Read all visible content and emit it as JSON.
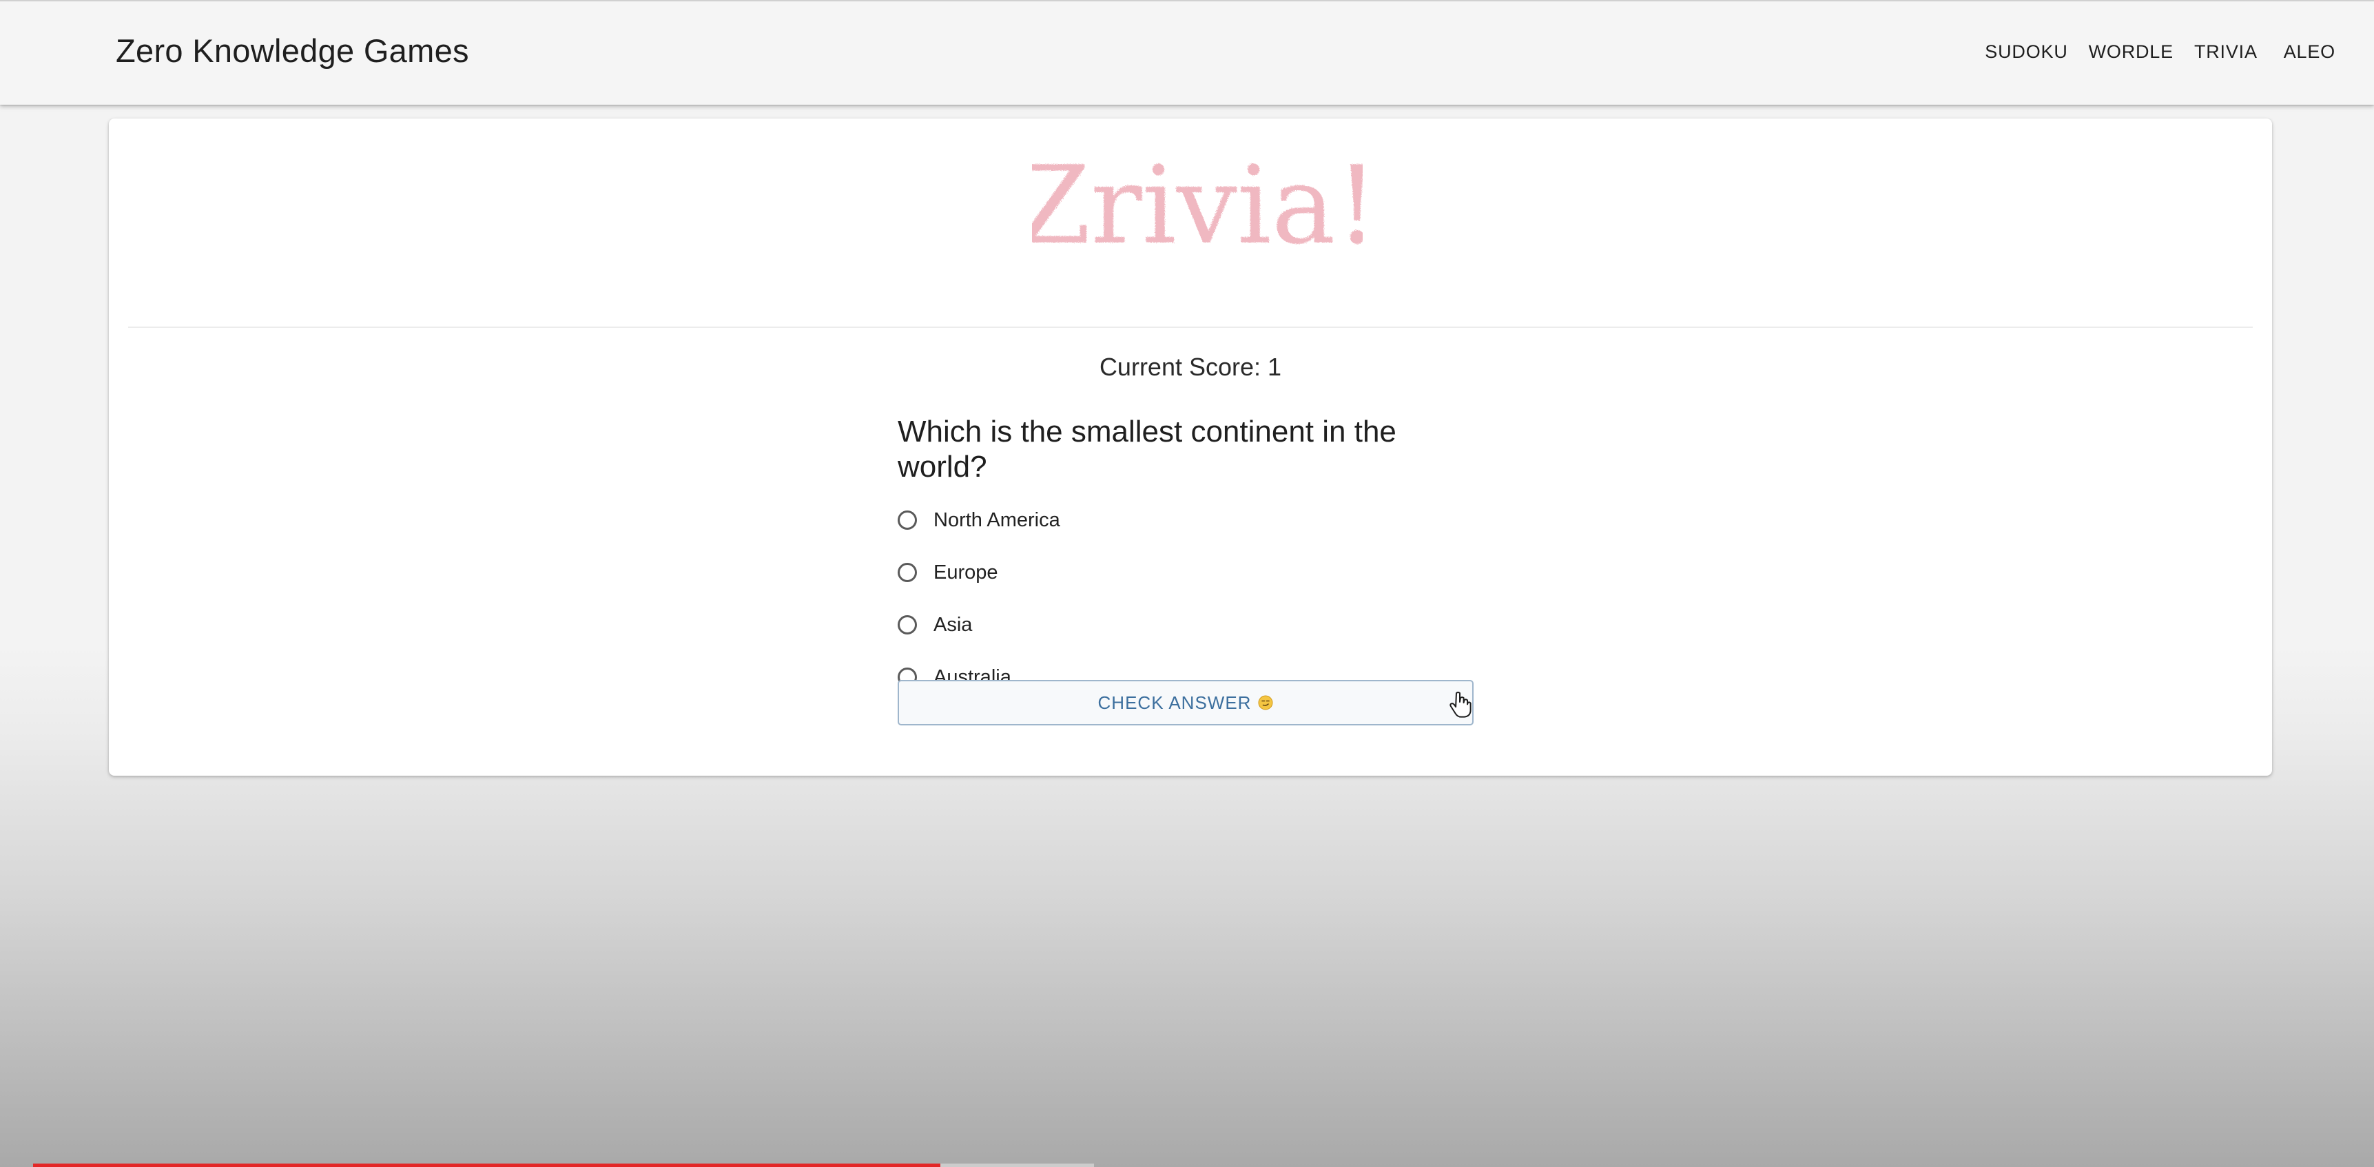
{
  "appbar": {
    "brand": "Zero Knowledge Games",
    "nav": [
      "SUDOKU",
      "WORDLE",
      "TRIVIA",
      "ALEO"
    ]
  },
  "logo": {
    "text": "Zrivia!",
    "color": "#f0b8c1"
  },
  "score": {
    "text": "Current Score: 1"
  },
  "quiz": {
    "question": "Which is the smallest continent in the world?",
    "options": [
      "North America",
      "Europe",
      "Asia",
      "Australia"
    ]
  },
  "check_button": {
    "label": "CHECK ANSWER",
    "icon": "smirk-emoji-icon"
  },
  "video_progress": {
    "fraction": 0.855,
    "color": "#e32727"
  }
}
